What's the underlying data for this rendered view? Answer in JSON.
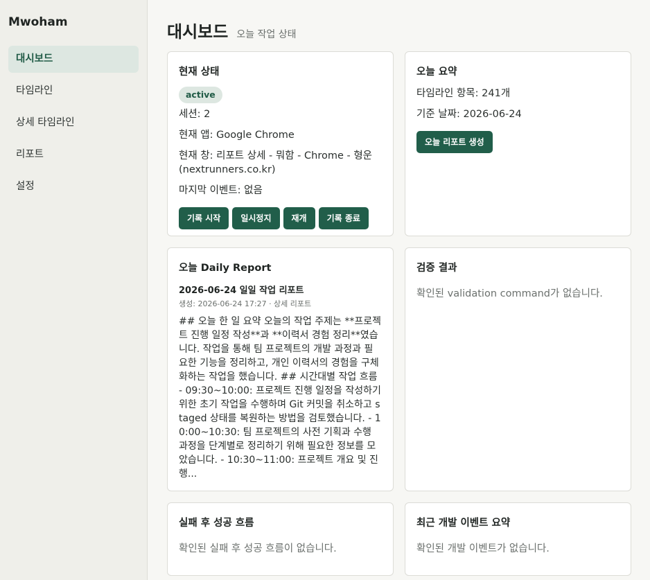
{
  "app": {
    "brand": "Mwoham"
  },
  "sidebar": {
    "items": [
      {
        "label": "대시보드"
      },
      {
        "label": "타임라인"
      },
      {
        "label": "상세 타임라인"
      },
      {
        "label": "리포트"
      },
      {
        "label": "설정"
      }
    ],
    "active_index": 0
  },
  "header": {
    "title": "대시보드",
    "subtitle": "오늘 작업 상태"
  },
  "status_card": {
    "title": "현재 상태",
    "badge": "active",
    "session": "세션: 2",
    "current_app": "현재 앱: Google Chrome",
    "current_window": "현재 창: 리포트 상세 - 뭐함 - Chrome - 형운 (nextrunners.co.kr)",
    "last_event": "마지막 이벤트: 없음",
    "buttons": {
      "start": "기록 시작",
      "pause": "일시정지",
      "resume": "재개",
      "stop": "기록 종료"
    }
  },
  "summary_card": {
    "title": "오늘 요약",
    "timeline_count": "타임라인 항목: 241개",
    "base_date": "기준 날짜: 2026-06-24",
    "generate_button": "오늘 리포트 생성"
  },
  "report_card": {
    "title": "오늘 Daily Report",
    "report_title": "2026-06-24 일일 작업 리포트",
    "meta": "생성: 2026-06-24 17:27 · 상세 리포트",
    "body": "## 오늘 한 일 요약 오늘의 작업 주제는 **프로젝트 진행 일정 작성**과 **이력서 경험 정리**였습니다. 작업을 통해 팀 프로젝트의 개발 과정과 필요한 기능을 정리하고, 개인 이력서의 경험을 구체화하는 작업을 했습니다. ## 시간대별 작업 흐름 - 09:30~10:00: 프로젝트 진행 일정을 작성하기 위한 초기 작업을 수행하며 Git 커밋을 취소하고 staged 상태를 복원하는 방법을 검토했습니다. - 10:00~10:30: 팀 프로젝트의 사전 기획과 수행 과정을 단계별로 정리하기 위해 필요한 정보를 모았습니다. - 10:30~11:00: 프로젝트 개요 및 진행..."
  },
  "validation_card": {
    "title": "검증 결과",
    "empty": "확인된 validation command가 없습니다."
  },
  "failure_card": {
    "title": "실패 후 성공 흐름",
    "empty": "확인된 실패 후 성공 흐름이 없습니다."
  },
  "dev_events_card": {
    "title": "최근 개발 이벤트 요약",
    "empty": "확인된 개발 이벤트가 없습니다."
  },
  "colors": {
    "accent": "#215e4a",
    "accent_soft": "#dde7e1",
    "sidebar_bg": "#efefea",
    "page_bg": "#f7f7f4"
  }
}
